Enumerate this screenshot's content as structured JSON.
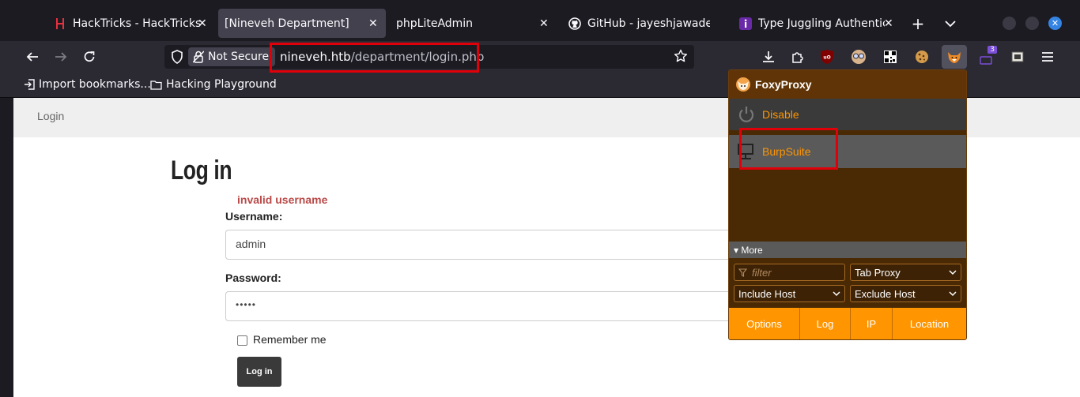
{
  "tabs": [
    {
      "title": "HackTricks - HackTricks",
      "close": "✕",
      "icon": "hacktricks-icon"
    },
    {
      "title": "[Nineveh Department]",
      "close": "✕",
      "active": true
    },
    {
      "title": "phpLiteAdmin",
      "close": "✕"
    },
    {
      "title": "GitHub - jayeshjawade/Br",
      "icon": "github-icon"
    },
    {
      "title": "Type Juggling Authenticat",
      "close": "✕",
      "icon": "invicti-icon"
    }
  ],
  "tabbar": {
    "new_tab": "+",
    "list_tabs": "⌄",
    "close_window": "✕"
  },
  "urlbar": {
    "security_label": "Not Secure",
    "host": "nineveh.htb",
    "path": "/department/login.php"
  },
  "extensions": {
    "badge_count": "3"
  },
  "bookmarks": [
    {
      "label": "Import bookmarks..."
    },
    {
      "label": "Hacking Playground"
    }
  ],
  "page": {
    "nav_link": "Login",
    "heading": "Log in",
    "error": "invalid username",
    "username_label": "Username:",
    "username_value": "admin",
    "password_label": "Password:",
    "password_value": "•••••",
    "remember_label": "Remember me",
    "login_button": "Log in"
  },
  "foxyproxy": {
    "title": "FoxyProxy",
    "items": [
      {
        "label": "Disable",
        "icon": "power-icon"
      },
      {
        "label": "BurpSuite",
        "icon": "monitor-icon"
      }
    ],
    "more_label": "▾ More",
    "filter_placeholder": "filter",
    "tab_proxy": "Tab Proxy",
    "include_host": "Include Host",
    "exclude_host": "Exclude Host",
    "buttons": [
      "Options",
      "Log",
      "IP",
      "Location"
    ]
  },
  "colors": {
    "accent_orange": "#ff9500",
    "highlight_red": "#e0000a",
    "chrome_dark": "#1c1b22",
    "error_red": "#b94a48"
  }
}
